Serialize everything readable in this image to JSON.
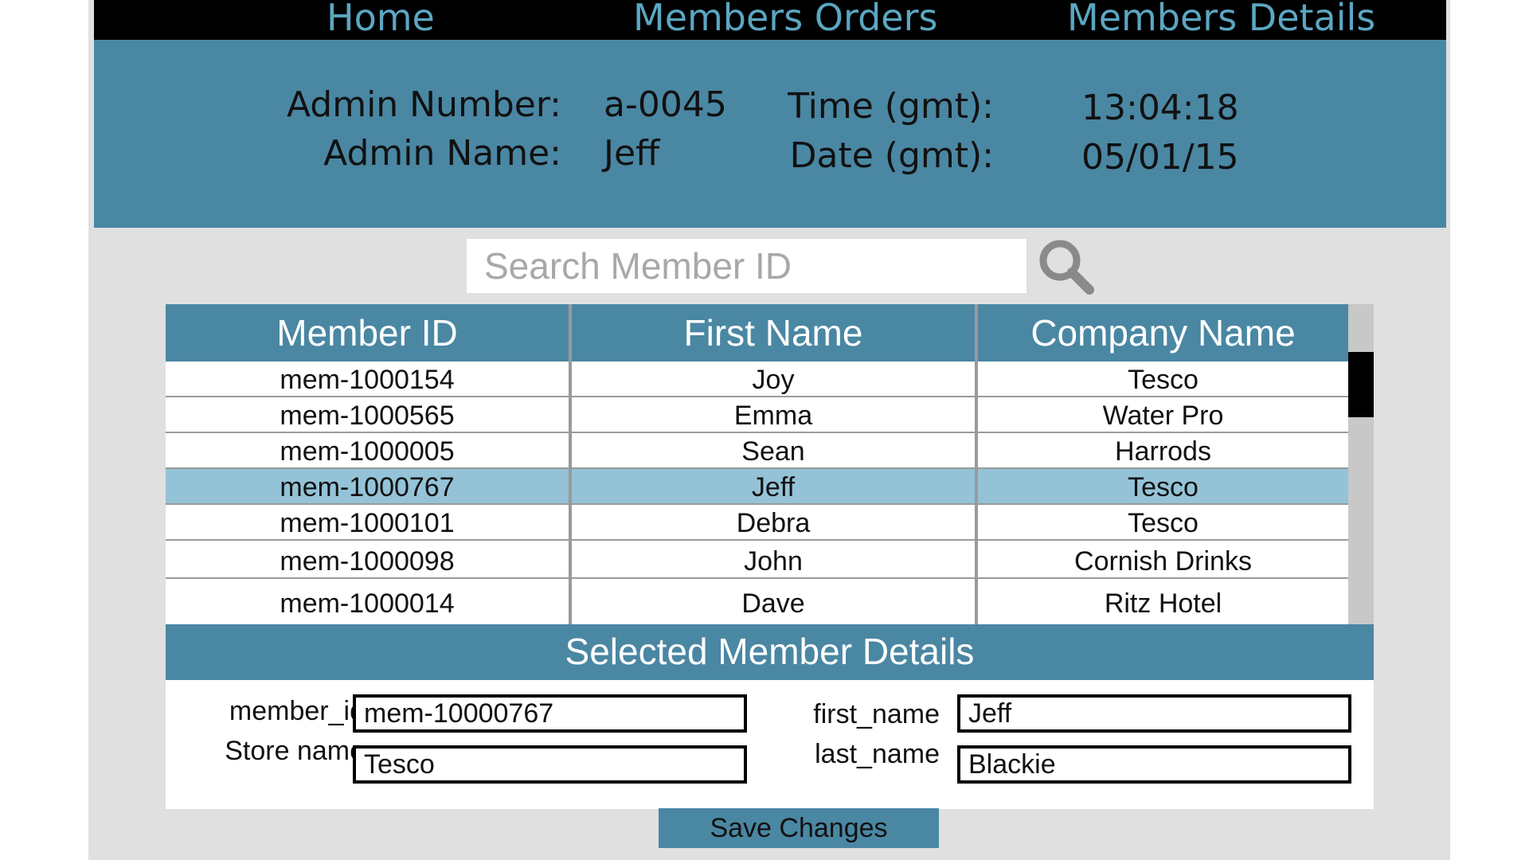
{
  "nav": {
    "home": "Home",
    "orders": "Members Orders",
    "details": "Members Details"
  },
  "header": {
    "admin_number_label": "Admin Number:",
    "admin_number": "a-0045",
    "admin_name_label": "Admin Name:",
    "admin_name": "Jeff",
    "time_label": "Time (gmt):",
    "time": "13:04:18",
    "date_label": "Date (gmt):",
    "date": "05/01/15"
  },
  "search": {
    "placeholder": "Search Member ID",
    "icon": "search-icon"
  },
  "table": {
    "columns": [
      "Member ID",
      "First Name",
      "Company Name"
    ],
    "selected_row": 3,
    "rows": [
      [
        "mem-1000154",
        "Joy",
        "Tesco"
      ],
      [
        "mem-1000565",
        "Emma",
        "Water Pro"
      ],
      [
        "mem-1000005",
        "Sean",
        "Harrods"
      ],
      [
        "mem-1000767",
        "Jeff",
        "Tesco"
      ],
      [
        "mem-1000101",
        "Debra",
        "Tesco"
      ],
      [
        "mem-1000098",
        "John",
        "Cornish Drinks"
      ],
      [
        "mem-1000014",
        "Dave",
        "Ritz Hotel"
      ]
    ]
  },
  "details": {
    "title": "Selected Member Details",
    "member_id_label": "member_id",
    "member_id": "mem-10000767",
    "store_name_label": "Store name",
    "store_name": "Tesco",
    "first_name_label": "first_name",
    "first_name": "Jeff",
    "last_name_label": "last_name",
    "last_name": "Blackie"
  },
  "save_label": "Save Changes",
  "colors": {
    "accent": "#4a87a3",
    "selected_row": "#94c3d7",
    "nav_text": "#5ba6c2",
    "background": "#e0e0e0"
  }
}
